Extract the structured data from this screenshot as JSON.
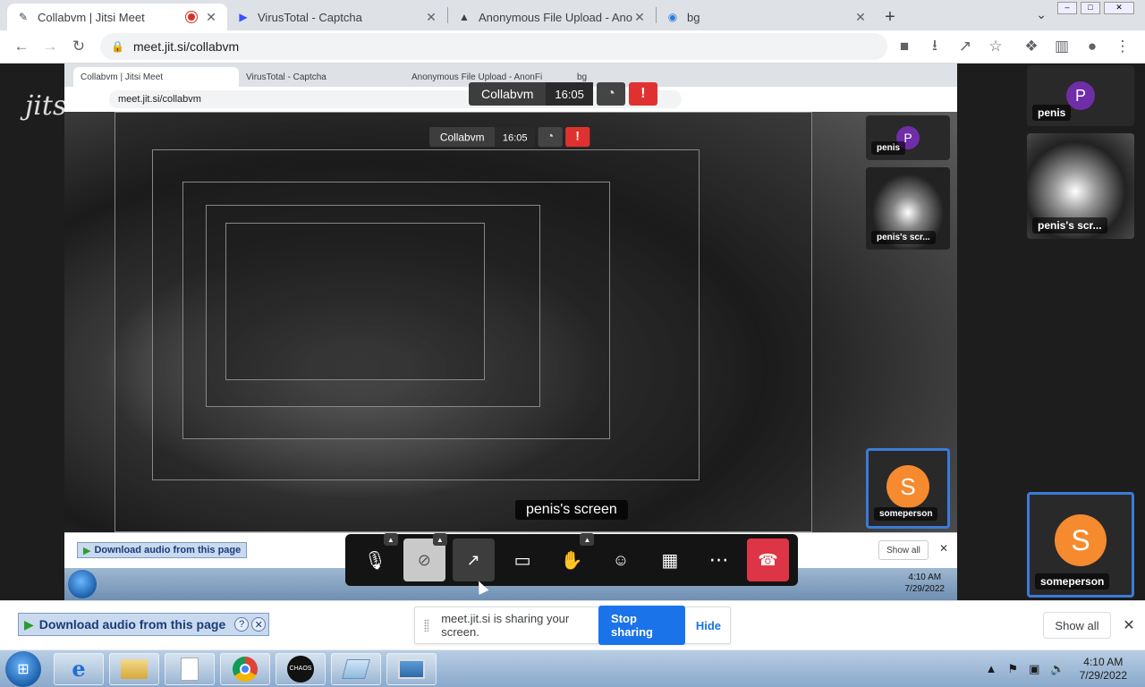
{
  "browser": {
    "tabs": [
      {
        "title": "Collabvm | Jitsi Meet",
        "icon": "jitsi-icon",
        "recording": true
      },
      {
        "title": "VirusTotal - Captcha",
        "icon": "virustotal-icon"
      },
      {
        "title": "Anonymous File Upload - AnonFiles",
        "icon": "anonfiles-icon"
      },
      {
        "title": "bg",
        "icon": "bg-icon"
      }
    ],
    "url": "meet.jit.si/collabvm"
  },
  "inner_browser": {
    "tabs": [
      "Collabvm | Jitsi Meet",
      "VirusTotal - Captcha",
      "Anonymous File Upload - AnonFi",
      "bg"
    ],
    "url": "meet.jit.si/collabvm"
  },
  "meeting": {
    "name": "Collabvm",
    "time": "16:05",
    "participants": [
      {
        "name": "penis",
        "initial": "P",
        "color": "#6f2da8"
      },
      {
        "name": "penis's scr...",
        "screen": true
      },
      {
        "name": "someperson",
        "initial": "S",
        "color": "#f58a2e",
        "muted": true
      }
    ],
    "screen_label": "penis's screen"
  },
  "watermark": "jitsi",
  "download_bar": {
    "item": "Download audio from this page",
    "show_all": "Show all"
  },
  "inner_download": {
    "item": "Download audio from this page",
    "show_all": "Show all"
  },
  "sharing": {
    "message": "meet.jit.si is sharing your screen.",
    "stop": "Stop sharing",
    "hide": "Hide"
  },
  "taskbar": {
    "time": "4:10 AM",
    "date": "7/29/2022",
    "apps": [
      "ie-icon",
      "folder-icon",
      "document-icon",
      "chrome-icon",
      "chaos-icon",
      "notepad-icon",
      "picture-icon"
    ],
    "chaos_label": "CHAOS"
  },
  "inner_taskbar": {
    "time": "4:10 AM",
    "date": "7/29/2022"
  }
}
